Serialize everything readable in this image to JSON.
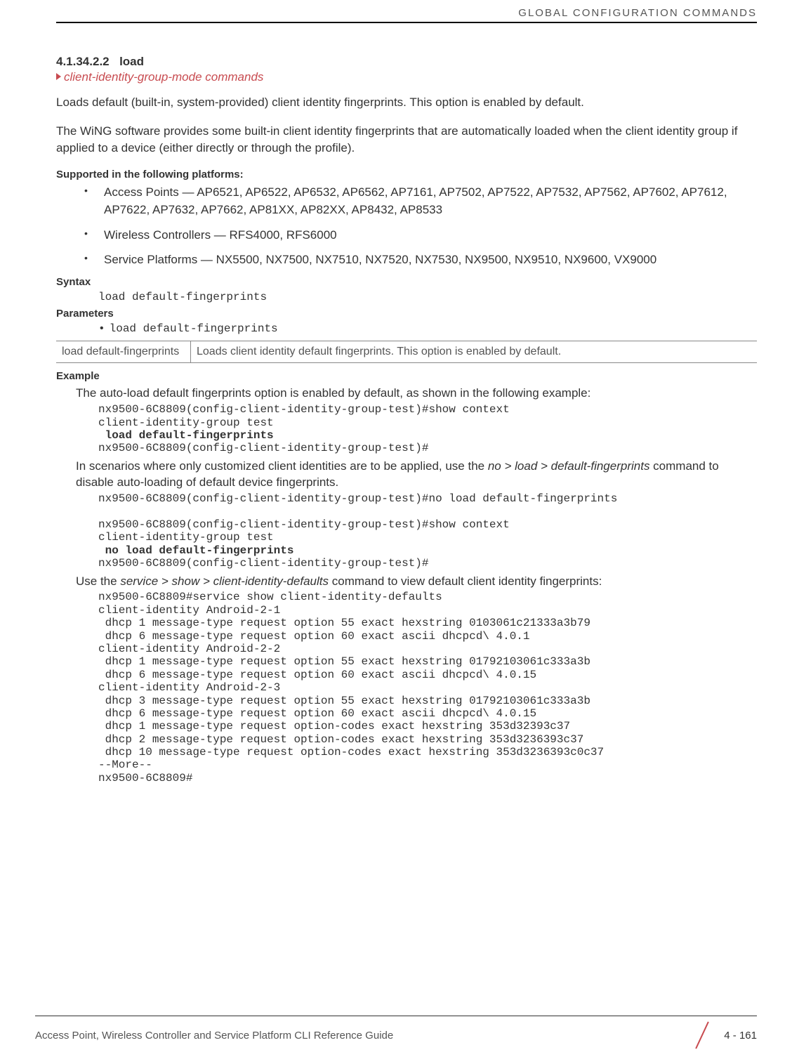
{
  "header": {
    "running": "GLOBAL CONFIGURATION COMMANDS"
  },
  "section": {
    "number": "4.1.34.2.2",
    "title": "load",
    "breadcrumb": "client-identity-group-mode commands"
  },
  "intro": {
    "p1": "Loads default (built-in, system-provided) client identity fingerprints. This option is enabled by default.",
    "p2": "The WiNG software provides some built-in client identity fingerprints that are automatically loaded when the client identity group if applied to a device (either directly or through the profile)."
  },
  "supported": {
    "heading": "Supported in the following platforms:",
    "items": [
      "Access Points — AP6521, AP6522, AP6532, AP6562, AP7161, AP7502, AP7522, AP7532, AP7562, AP7602, AP7612, AP7622, AP7632, AP7662, AP81XX, AP82XX, AP8432, AP8533",
      "Wireless Controllers — RFS4000, RFS6000",
      "Service Platforms — NX5500, NX7500, NX7510, NX7520, NX7530, NX9500, NX9510, NX9600, VX9000"
    ]
  },
  "syntax": {
    "heading": "Syntax",
    "code": "load default-fingerprints"
  },
  "parameters": {
    "heading": "Parameters",
    "line": "load default-fingerprints",
    "table": {
      "key": "load default-fingerprints",
      "desc": "Loads client identity default fingerprints. This option is enabled by default."
    }
  },
  "example": {
    "heading": "Example",
    "intro1": "The auto-load default fingerprints option is enabled by default, as shown in the following example:",
    "code1_l1": "nx9500-6C8809(config-client-identity-group-test)#show context",
    "code1_l2": "client-identity-group test",
    "code1_l3": " load default-fingerprints",
    "code1_l4": "nx9500-6C8809(config-client-identity-group-test)#",
    "intro2a": "In scenarios where only customized client identities are to be applied, use the ",
    "intro2b_it": "no > load > default-fingerprints",
    "intro2c": " command to disable auto-loading of default device fingerprints.",
    "code2_l1": "nx9500-6C8809(config-client-identity-group-test)#no load default-fingerprints",
    "code2_blank": "",
    "code2_l2": "nx9500-6C8809(config-client-identity-group-test)#show context",
    "code2_l3": "client-identity-group test",
    "code2_l4": " no load default-fingerprints",
    "code2_l5": "nx9500-6C8809(config-client-identity-group-test)#",
    "intro3a": "Use the ",
    "intro3b_it": "service > show > client-identity-defaults",
    "intro3c": " command to view default client identity fingerprints:",
    "code3": "nx9500-6C8809#service show client-identity-defaults\nclient-identity Android-2-1\n dhcp 1 message-type request option 55 exact hexstring 0103061c21333a3b79\n dhcp 6 message-type request option 60 exact ascii dhcpcd\\ 4.0.1\nclient-identity Android-2-2\n dhcp 1 message-type request option 55 exact hexstring 01792103061c333a3b\n dhcp 6 message-type request option 60 exact ascii dhcpcd\\ 4.0.15\nclient-identity Android-2-3\n dhcp 3 message-type request option 55 exact hexstring 01792103061c333a3b\n dhcp 6 message-type request option 60 exact ascii dhcpcd\\ 4.0.15\n dhcp 1 message-type request option-codes exact hexstring 353d32393c37\n dhcp 2 message-type request option-codes exact hexstring 353d3236393c37\n dhcp 10 message-type request option-codes exact hexstring 353d3236393c0c37\n--More--\nnx9500-6C8809#"
  },
  "footer": {
    "left": "Access Point, Wireless Controller and Service Platform CLI Reference Guide",
    "page": "4 - 161"
  }
}
